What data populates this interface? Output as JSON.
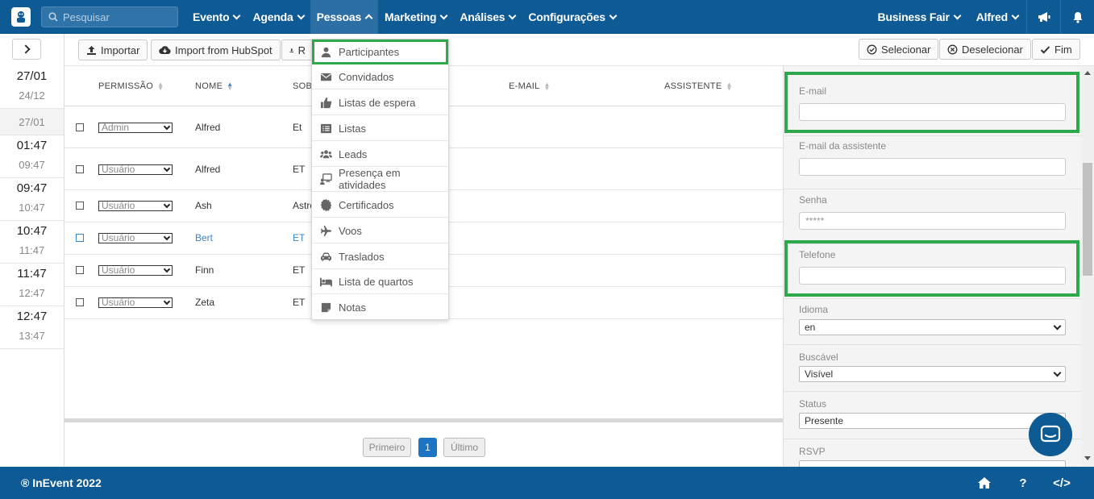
{
  "topbar": {
    "search_placeholder": "Pesquisar",
    "nav": [
      "Evento",
      "Agenda",
      "Pessoas",
      "Marketing",
      "Análises",
      "Configurações"
    ],
    "active_nav": "Pessoas",
    "company": "Business Fair",
    "user": "Alfred"
  },
  "timeline": {
    "blocks": [
      {
        "start": "27/01",
        "end": "24/12"
      },
      {
        "single": "27/01"
      },
      {
        "start": "01:47",
        "end": "09:47"
      },
      {
        "start": "09:47",
        "end": "10:47"
      },
      {
        "start": "10:47",
        "end": "11:47"
      },
      {
        "start": "11:47",
        "end": "12:47"
      },
      {
        "start": "12:47",
        "end": "13:47"
      }
    ]
  },
  "toolbar": {
    "import": "Importar",
    "hubspot": "Import from HubSpot",
    "third": "R",
    "select": "Selecionar",
    "deselect": "Deselecionar",
    "done": "Fim"
  },
  "table": {
    "headers": [
      "PERMISSÃO",
      "NOME",
      "SOBI",
      "E-MAIL",
      "ASSISTENTE"
    ],
    "rows": [
      {
        "permission": "Admin",
        "name": "Alfred",
        "surname": "Et"
      },
      {
        "permission": "Usuário",
        "name": "Alfred",
        "surname": "ET"
      },
      {
        "permission": "Usuário",
        "name": "Ash",
        "surname": "Astro"
      },
      {
        "permission": "Usuário",
        "name": "Bert",
        "surname": "ET"
      },
      {
        "permission": "Usuário",
        "name": "Finn",
        "surname": "ET"
      },
      {
        "permission": "Usuário",
        "name": "Zeta",
        "surname": "ET"
      }
    ]
  },
  "pagination": {
    "first": "Primeiro",
    "current": "1",
    "last": "Último"
  },
  "dropdown": {
    "items": [
      "Participantes",
      "Convidados",
      "Listas de espera",
      "Listas",
      "Leads",
      "Presença em atividades",
      "Certificados",
      "Voos",
      "Traslados",
      "Lista de quartos",
      "Notas"
    ]
  },
  "form": {
    "email_label": "E-mail",
    "assistant_email_label": "E-mail da assistente",
    "password_label": "Senha",
    "password_value": "*****",
    "phone_label": "Telefone",
    "language_label": "Idioma",
    "language_value": "en",
    "searchable_label": "Buscável",
    "searchable_value": "Visível",
    "status_label": "Status",
    "status_value": "Presente",
    "rsvp_label": "RSVP"
  },
  "footer": {
    "copyright": "® InEvent 2022",
    "help": "?",
    "code": "</>"
  },
  "colors": {
    "brand": "#0d5a95",
    "highlight": "#2da84a",
    "link": "#3a87c8"
  }
}
